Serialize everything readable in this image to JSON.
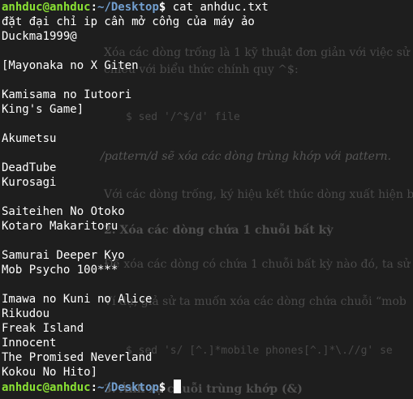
{
  "background_document": {
    "lines": [
      "Xóa các dòng trống là 1 kỹ thuật đơn giản với việc sử",
      "chiều với biểu thức chính quy ^$:",
      "$ sed '/^$/d' file",
      "/pattern/d sẽ xóa các dòng trùng khớp với pattern.",
      "Với các dòng trống, ký hiệu kết thúc dòng xuất hiện b",
      "2. Xóa các dòng chứa 1 chuỗi bất kỳ",
      "Để xóa các dòng có chứa 1 chuỗi bất kỳ nào đó, ta sử",
      "Ví dụ, giả sử ta muốn xóa các dòng chứa chuỗi “mob",
      "$ sed 's/ [^.]*mobile phones[^.]*\\.//g' se",
      "3. Ánh xạ chuỗi trùng khớp (&)"
    ]
  },
  "terminal": {
    "prompt": {
      "user_host": "anhduc@anhduc",
      "separator": ":",
      "path": "~/Desktop",
      "symbol": "$"
    },
    "command": " cat anhduc.txt",
    "output_lines": [
      "đặt đại chỉ ip cần mở cổng của máy ảo",
      "Duckma1999@",
      "",
      "[Mayonaka no X Giten",
      "",
      "Kamisama no Iutoori",
      "King's Game]",
      "",
      "Akumetsu",
      "",
      "DeadTube",
      "Kurosagi",
      "",
      "Saiteihen No Otoko",
      "Kotaro Makaritoru",
      "",
      "Samurai Deeper Kyo",
      "Mob Psycho 100***",
      "",
      "Imawa no Kuni no Alice",
      "Rikudou",
      "Freak Island",
      "Innocent",
      "The Promised Neverland",
      "Kokou No Hito]"
    ]
  }
}
